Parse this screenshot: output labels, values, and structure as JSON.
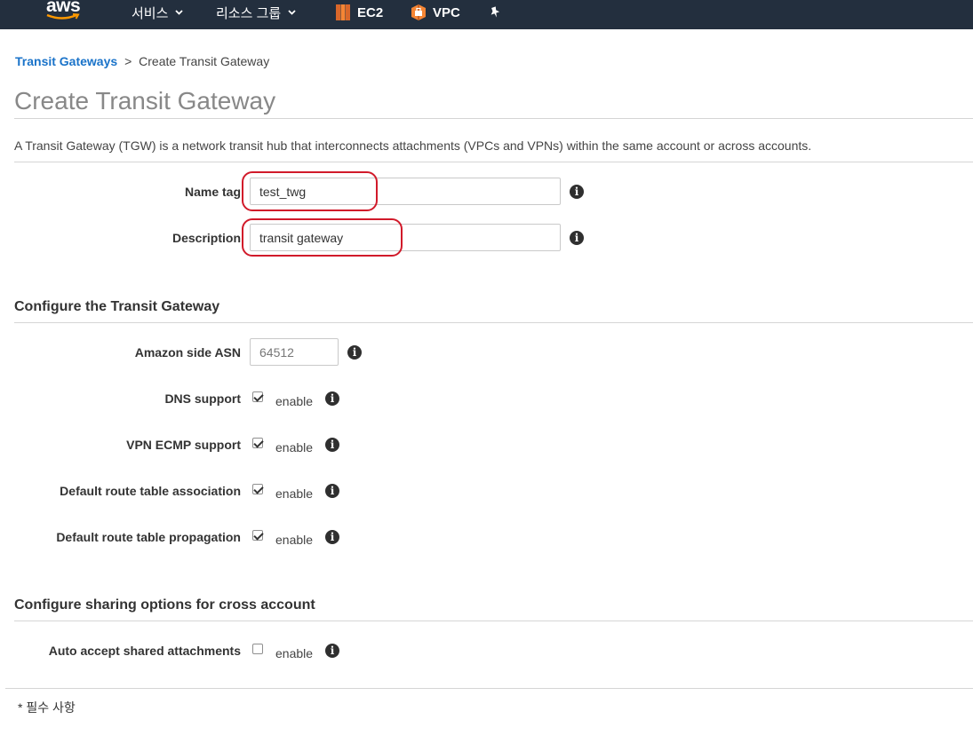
{
  "topbar": {
    "logo_text": "aws",
    "services": "서비스",
    "resource_groups": "리소스 그룹",
    "ec2": "EC2",
    "vpc": "VPC"
  },
  "breadcrumb": {
    "parent": "Transit Gateways",
    "separator": ">",
    "current": "Create Transit Gateway"
  },
  "page": {
    "title": "Create Transit Gateway",
    "intro": "A Transit Gateway (TGW) is a network transit hub that interconnects attachments (VPCs and VPNs) within the same account or across accounts."
  },
  "general": {
    "name_tag_label": "Name tag",
    "name_tag_value": "test_twg",
    "description_label": "Description",
    "description_value": "transit gateway"
  },
  "configure": {
    "title": "Configure the Transit Gateway",
    "asn_label": "Amazon side ASN",
    "asn_value": "64512",
    "options": [
      {
        "label": "DNS support",
        "checked": true,
        "enable": "enable"
      },
      {
        "label": "VPN ECMP support",
        "checked": true,
        "enable": "enable"
      },
      {
        "label": "Default route table association",
        "checked": true,
        "enable": "enable"
      },
      {
        "label": "Default route table propagation",
        "checked": true,
        "enable": "enable"
      }
    ]
  },
  "sharing": {
    "title": "Configure sharing options for cross account",
    "auto_accept_label": "Auto accept shared attachments",
    "auto_accept_checked": false,
    "enable": "enable"
  },
  "footer": {
    "required_note": "* 필수 사항"
  },
  "colors": {
    "nav_bg": "#232f3e",
    "link": "#1a73c9",
    "highlight": "#d11a2a",
    "service_icon": "#f58534"
  },
  "icons": {
    "info": "info-icon",
    "pin": "pin-icon",
    "caret": "chevron-down-icon"
  }
}
